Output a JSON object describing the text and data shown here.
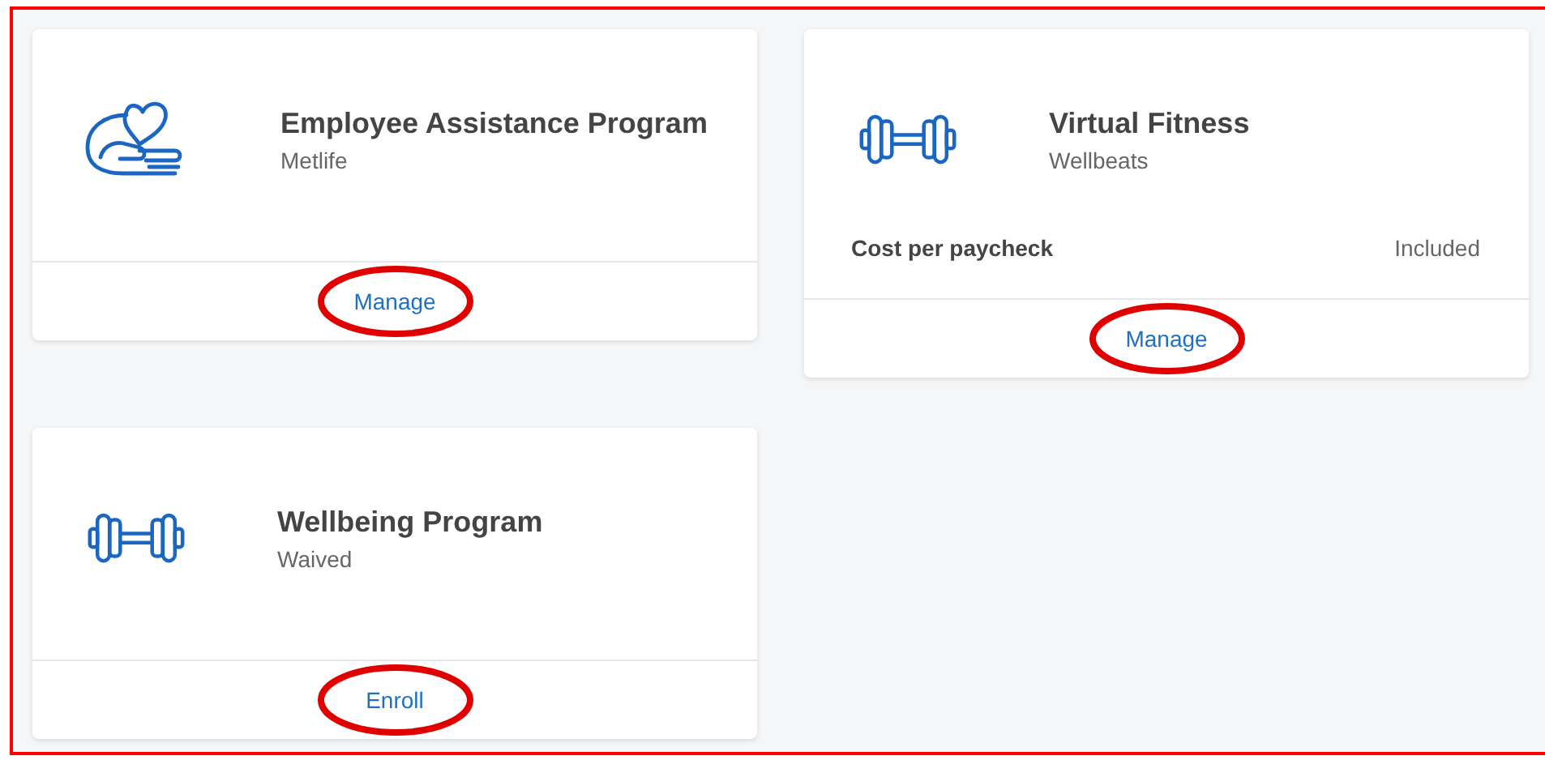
{
  "cards": [
    {
      "kind": "hand-heart",
      "title": "Employee Assistance Program",
      "subtitle": "Metlife",
      "action": {
        "label": "Manage",
        "highlighted": true
      }
    },
    {
      "kind": "dumbbell",
      "title": "Virtual Fitness",
      "subtitle": "Wellbeats",
      "details": [
        {
          "label": "Cost per paycheck",
          "value": "Included"
        }
      ],
      "action": {
        "label": "Manage",
        "highlighted": true
      }
    },
    {
      "kind": "dumbbell",
      "title": "Wellbeing Program",
      "subtitle": "Waived",
      "action": {
        "label": "Enroll",
        "highlighted": true
      }
    }
  ]
}
